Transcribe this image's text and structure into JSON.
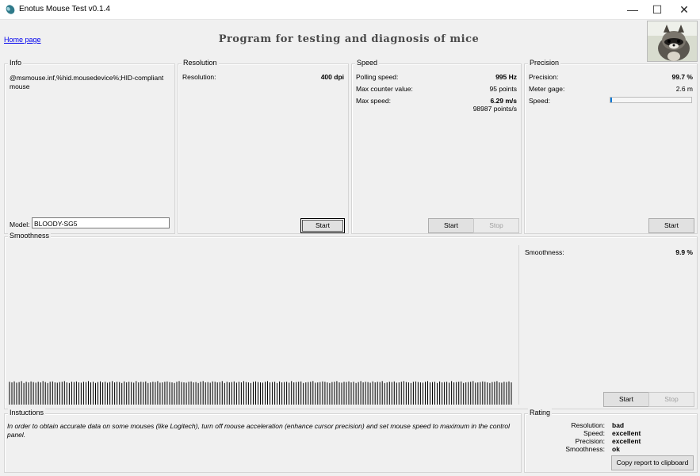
{
  "window": {
    "title": "Enotus Mouse Test v0.1.4",
    "minimize_glyph": "—",
    "maximize_glyph": "☐",
    "close_glyph": "✕"
  },
  "header": {
    "home_link": "Home page",
    "banner": "Program for testing and diagnosis of mice"
  },
  "info": {
    "legend": "Info",
    "device": "@msmouse.inf,%hid.mousedevice%;HID-compliant mouse",
    "model_label": "Model:",
    "model_value": "BLOODY-SG5"
  },
  "resolution": {
    "legend": "Resolution",
    "label": "Resolution:",
    "value": "400 dpi",
    "start_button": "Start"
  },
  "speed": {
    "legend": "Speed",
    "polling_label": "Polling speed:",
    "polling_value": "995 Hz",
    "max_counter_label": "Max counter value:",
    "max_counter_value": "95 points",
    "max_speed_label": "Max  speed:",
    "max_speed_value": "6.29 m/s",
    "max_speed_points": "98987 points/s",
    "start_button": "Start",
    "stop_button": "Stop"
  },
  "precision": {
    "legend": "Precision",
    "precision_label": "Precision:",
    "precision_value": "99.7 %",
    "meter_label": "Meter gage:",
    "meter_value": "2.6 m",
    "speed_label": "Speed:",
    "speed_fraction": 0.02,
    "start_button": "Start"
  },
  "smoothness": {
    "legend": "Smoothness",
    "label": "Smoothness:",
    "value": "9.9 %",
    "start_button": "Start",
    "stop_button": "Stop",
    "bar_heights": [
      0.72,
      0.7,
      0.73,
      0.69,
      0.71,
      0.74,
      0.68,
      0.72,
      0.7,
      0.73,
      0.71,
      0.69,
      0.72,
      0.7,
      0.74,
      0.71,
      0.68,
      0.72,
      0.73,
      0.7,
      0.69,
      0.71,
      0.72,
      0.74,
      0.7,
      0.68,
      0.72,
      0.71,
      0.73,
      0.7,
      0.69,
      0.72,
      0.71,
      0.74,
      0.7,
      0.72,
      0.68,
      0.71,
      0.73,
      0.7,
      0.72,
      0.69,
      0.71,
      0.74,
      0.7,
      0.72,
      0.71,
      0.68,
      0.73,
      0.7,
      0.72,
      0.71,
      0.69,
      0.74,
      0.7,
      0.72,
      0.71,
      0.73,
      0.68,
      0.7,
      0.72,
      0.71,
      0.74,
      0.69,
      0.7,
      0.72,
      0.73,
      0.71,
      0.7,
      0.68,
      0.72,
      0.74,
      0.71,
      0.7,
      0.69,
      0.72,
      0.73,
      0.7,
      0.71,
      0.68,
      0.72,
      0.74,
      0.7,
      0.71,
      0.69,
      0.73,
      0.72,
      0.7,
      0.71,
      0.74,
      0.68,
      0.72,
      0.7,
      0.71,
      0.73,
      0.69,
      0.72,
      0.7,
      0.74,
      0.71,
      0.7,
      0.68,
      0.72,
      0.73,
      0.71,
      0.7,
      0.69,
      0.72,
      0.74,
      0.7,
      0.71,
      0.72,
      0.68,
      0.73,
      0.7,
      0.71,
      0.72,
      0.69,
      0.74,
      0.7,
      0.71,
      0.72,
      0.73,
      0.68,
      0.7,
      0.71,
      0.72,
      0.74,
      0.69,
      0.7,
      0.71,
      0.73,
      0.72,
      0.7,
      0.68,
      0.71,
      0.72,
      0.74,
      0.7,
      0.69,
      0.72,
      0.71,
      0.73,
      0.7,
      0.72,
      0.68,
      0.71,
      0.74,
      0.7,
      0.72,
      0.71,
      0.69,
      0.73,
      0.7,
      0.72,
      0.71,
      0.74,
      0.68,
      0.7,
      0.72,
      0.71,
      0.73,
      0.69,
      0.7,
      0.72,
      0.74,
      0.71,
      0.7,
      0.68,
      0.72,
      0.73,
      0.71,
      0.7,
      0.69,
      0.72,
      0.74,
      0.7,
      0.71,
      0.72,
      0.68,
      0.73,
      0.7,
      0.71,
      0.72,
      0.69,
      0.74,
      0.7,
      0.71,
      0.72,
      0.73,
      0.68,
      0.7,
      0.71,
      0.72,
      0.74,
      0.69,
      0.7,
      0.71,
      0.73,
      0.72,
      0.7,
      0.68,
      0.71,
      0.72,
      0.74,
      0.7,
      0.69,
      0.72,
      0.71,
      0.73,
      0.7
    ]
  },
  "instructions": {
    "legend": "Instuctions",
    "text": "In order to obtain accurate data on some mouses (like Logitech), turn off mouse acceleration (enhance cursor precision) and set mouse speed to maximum in the control panel."
  },
  "rating": {
    "legend": "Rating",
    "rows": [
      {
        "label": "Resolution:",
        "value": "bad"
      },
      {
        "label": "Speed:",
        "value": "excellent"
      },
      {
        "label": "Precision:",
        "value": "excellent"
      },
      {
        "label": "Smoothness:",
        "value": "ok"
      }
    ],
    "copy_button": "Copy report to clipboard"
  },
  "colors": {
    "accent": "#0078d7",
    "link": "#0000ee",
    "graph_line": "#000000"
  }
}
